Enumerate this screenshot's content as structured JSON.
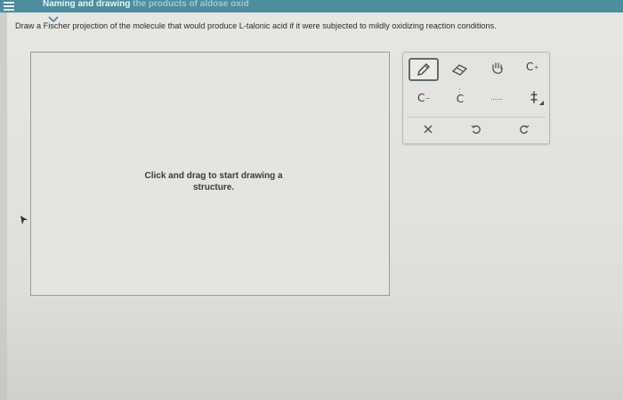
{
  "header": {
    "title_visible": "Naming and drawing",
    "title_faded": " the products of aldose oxid"
  },
  "question": {
    "prompt": "Draw a Fischer projection of the molecule that would produce L-talonic acid if it were subjected to mildly oxidizing reaction conditions."
  },
  "canvas": {
    "hint_line1": "Click and drag to start drawing a",
    "hint_line2": "structure."
  },
  "toolbar": {
    "tools": [
      {
        "name": "pencil-tool",
        "icon": "pencil-icon"
      },
      {
        "name": "eraser-tool",
        "icon": "eraser-icon"
      },
      {
        "name": "move-tool",
        "icon": "hand-icon"
      },
      {
        "name": "positive-charge-tool",
        "label": "C",
        "sup": "+"
      },
      {
        "name": "negative-charge-tool",
        "label": "C",
        "sup": "−"
      },
      {
        "name": "lone-pair-tool",
        "label": "C",
        "dots": ":"
      },
      {
        "name": "radical-tool",
        "label": "......"
      },
      {
        "name": "bond-tool",
        "label": "‡"
      },
      {
        "name": "clear-tool",
        "icon": "close-icon"
      },
      {
        "name": "undo-tool",
        "icon": "undo-icon"
      },
      {
        "name": "redo-tool",
        "icon": "redo-icon"
      }
    ]
  },
  "colors": {
    "header": "#4a8ea0",
    "canvas_border": "#9c9a97",
    "selected_tool_border": "#5d6b70"
  }
}
